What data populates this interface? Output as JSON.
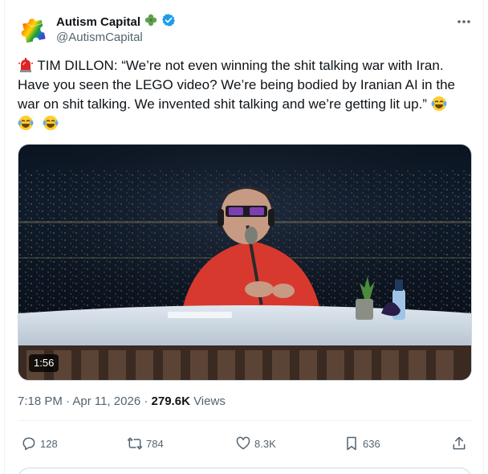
{
  "author": {
    "display_name": "Autism Capital",
    "handle": "@AutismCapital",
    "avatar_icon": "puzzle-piece-avatar",
    "badge_icon": "clover-emoji",
    "verified_icon": "verified-badge-icon",
    "verified_color": "#1d9bf0"
  },
  "tweet": {
    "lines": [
      "TIM DILLON: “We’re not even winning the shit talking war with Iran.",
      "Have you seen the LEGO video? We’re being bodied by Iranian AI in the",
      "war on shit talking. We invented shit talking and we’re getting lit up.”"
    ],
    "leading_emoji": "rotating-light-emoji",
    "trailing_emojis": [
      "laughing-tears-emoji",
      "laughing-tears-emoji",
      "laughing-tears-emoji"
    ]
  },
  "media": {
    "type": "video",
    "duration": "1:56"
  },
  "meta": {
    "time": "7:18 PM",
    "separator": "·",
    "date": "Apr 11, 2026",
    "views_count": "279.6K",
    "views_label": "Views"
  },
  "actions": {
    "replies": "128",
    "reposts": "784",
    "likes": "8.3K",
    "bookmarks": "636"
  },
  "colors": {
    "text": "#0f1419",
    "secondary": "#536471",
    "accent": "#1d9bf0"
  }
}
